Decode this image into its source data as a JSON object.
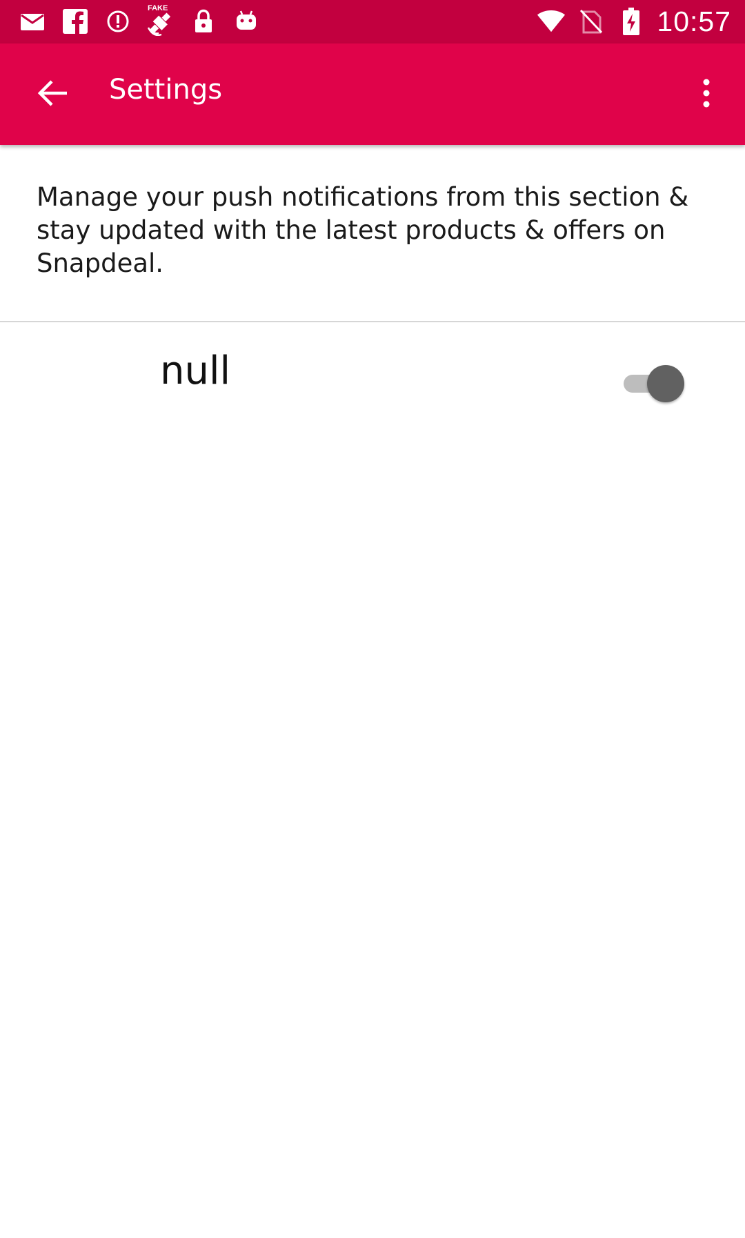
{
  "status_bar": {
    "time": "10:57",
    "left_icons": [
      "mail-icon",
      "facebook-icon",
      "alert-circle-icon",
      "fake-gps-icon",
      "lock-icon",
      "android-icon"
    ],
    "fake_gps_label": "FAKE",
    "right_icons": [
      "wifi-icon",
      "no-sim-icon",
      "battery-charging-icon"
    ],
    "color": "#c2003f"
  },
  "app_bar": {
    "title": "Settings",
    "back_icon": "arrow-left-icon",
    "overflow_icon": "more-vert-icon",
    "color": "#e0034a"
  },
  "description": "Manage your push notifications from this section & stay updated with the latest products & offers on Snapdeal.",
  "settings": [
    {
      "label": "null",
      "toggle_state": "off"
    }
  ]
}
